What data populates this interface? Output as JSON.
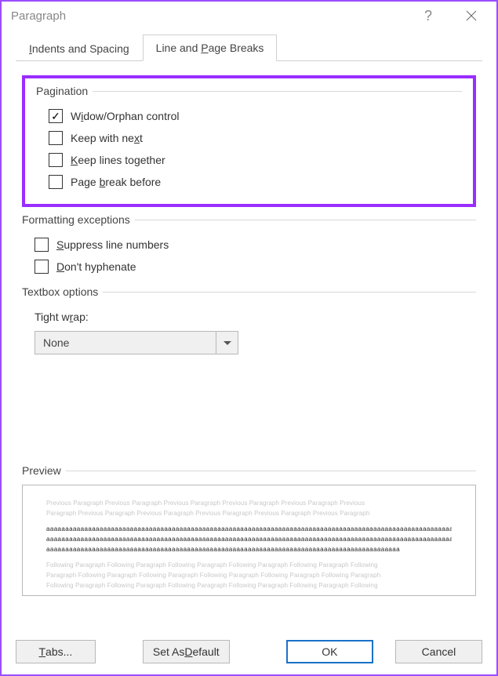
{
  "title": "Paragraph",
  "tabs": {
    "indents": "Indents and Spacing",
    "breaks": "Line and Page Breaks"
  },
  "pagination": {
    "header": "Pagination",
    "widow_pre": "W",
    "widow_u": "i",
    "widow_post": "dow/Orphan control",
    "keepnext_pre": "Keep with ne",
    "keepnext_u": "x",
    "keepnext_post": "t",
    "keeplines_pre": "",
    "keeplines_u": "K",
    "keeplines_post": "eep lines together",
    "pagebreak_pre": "Page ",
    "pagebreak_u": "b",
    "pagebreak_post": "reak before"
  },
  "formatting": {
    "header": "Formatting exceptions",
    "suppress_pre": "",
    "suppress_u": "S",
    "suppress_post": "uppress line numbers",
    "hyphen_pre": "",
    "hyphen_u": "D",
    "hyphen_post": "on't hyphenate"
  },
  "textbox": {
    "header": "Textbox options",
    "tight_pre": "Tight w",
    "tight_u": "r",
    "tight_post": "ap:",
    "value": "None"
  },
  "preview": {
    "header": "Preview",
    "ghost_before": "Previous Paragraph Previous Paragraph Previous Paragraph Previous Paragraph Previous Paragraph Previous",
    "ghost_before2": "Paragraph Previous Paragraph Previous Paragraph Previous Paragraph Previous Paragraph Previous Paragraph",
    "sample": "aaaaaaaaaaaaaaaaaaaaaaaaaaaaaaaaaaaaaaaaaaaaaaaaaaaaaaaaaaaaaaaaaaaaaaaaaaaaaaaaaaaaaaaaaaaaaaaaaaaaaaaaaaaaaaaaaaaa",
    "sample_last": "aaaaaaaaaaaaaaaaaaaaaaaaaaaaaaaaaaaaaaaaaaaaaaaaaaaaaaaaaaaaaaaaaaaaaaaaaaaaaaaaaaaaaaaaaaaaa",
    "ghost_after": "Following Paragraph Following Paragraph Following Paragraph Following Paragraph Following Paragraph Following",
    "ghost_after2": "Paragraph Following Paragraph Following Paragraph Following Paragraph Following Paragraph Following Paragraph",
    "ghost_after3": "Following Paragraph Following Paragraph Following Paragraph Following Paragraph Following Paragraph Following"
  },
  "buttons": {
    "tabs_pre": "",
    "tabs_u": "T",
    "tabs_post": "abs...",
    "default_pre": "Set As ",
    "default_u": "D",
    "default_post": "efault",
    "ok": "OK",
    "cancel": "Cancel"
  }
}
